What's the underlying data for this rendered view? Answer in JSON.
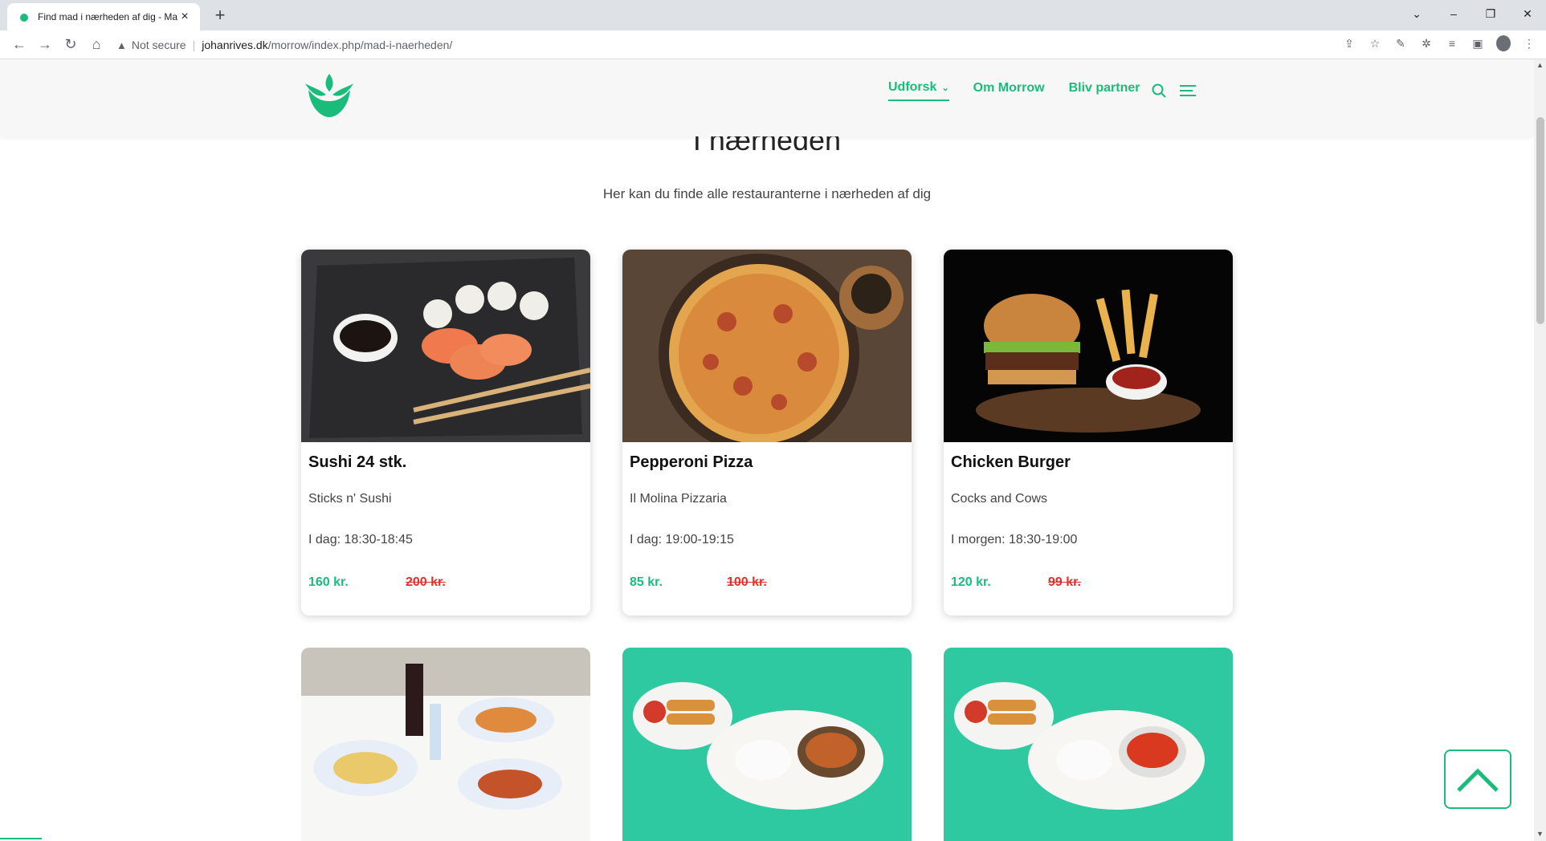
{
  "browser": {
    "tab_title": "Find mad i nærheden af dig - Ma",
    "new_tab": "+",
    "security_label": "Not secure",
    "url_host": "johanrives.dk",
    "url_path": "/morrow/index.php/mad-i-naerheden/"
  },
  "nav": {
    "items": [
      {
        "label": "Udforsk"
      },
      {
        "label": "Om Morrow"
      },
      {
        "label": "Bliv partner"
      }
    ]
  },
  "main": {
    "heading": "I nærheden",
    "subtitle": "Her kan du finde alle restauranterne i nærheden af dig"
  },
  "cards": [
    {
      "name": "Sushi 24 stk.",
      "restaurant": "Sticks n' Sushi",
      "time": "I dag: 18:30-18:45",
      "price": "160 kr.",
      "old_price": "200 kr."
    },
    {
      "name": "Pepperoni Pizza",
      "restaurant": "Il Molina Pizzaria",
      "time": "I dag: 19:00-19:15",
      "price": "85 kr.",
      "old_price": "100 kr."
    },
    {
      "name": "Chicken Burger",
      "restaurant": "Cocks and Cows",
      "time": "I morgen: 18:30-19:00",
      "price": "120 kr.",
      "old_price": "99 kr."
    }
  ],
  "colors": {
    "accent": "#1abc7b",
    "old_price": "#e03030"
  }
}
